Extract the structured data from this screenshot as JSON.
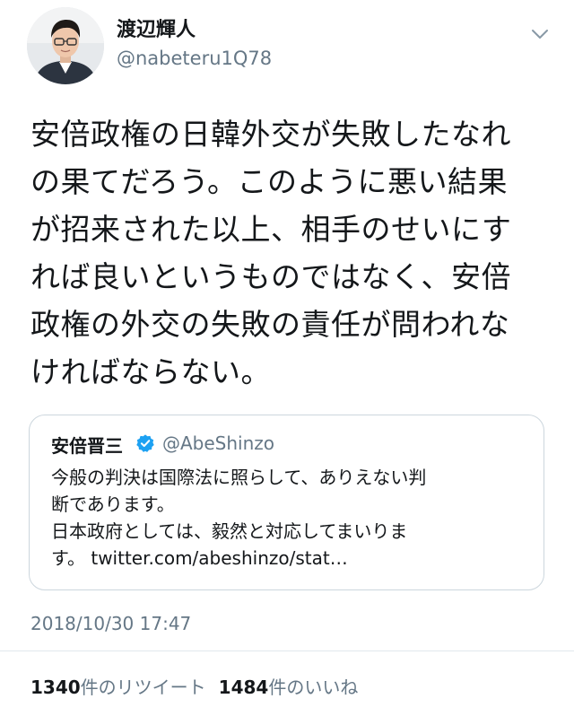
{
  "author": {
    "display_name": "渡辺輝人",
    "handle": "@nabeteru1Q78",
    "avatar_icon": "avatar-photo"
  },
  "menu_icon": "chevron-down-icon",
  "tweet_text_lines": [
    "安倍政権の日韓外交が失敗したなれ",
    "の果てだろう。このように悪い結果",
    "が招来された以上、相手のせいにす",
    "れば良いというものではなく、安倍",
    "政権の外交の失敗の責任が問われな",
    "ければならない。"
  ],
  "quoted_tweet": {
    "display_name": "安倍晋三",
    "verified_icon": "verified-badge-icon",
    "handle": "@AbeShinzo",
    "text_lines": [
      "今般の判決は国際法に照らして、ありえない判",
      "断であります。",
      "日本政府としては、毅然と対応してまいりま",
      "す。 twitter.com/abeshinzo/stat…"
    ]
  },
  "timestamp": "2018/10/30 17:47",
  "stats": {
    "retweet_count": "1340",
    "retweet_label": "件のリツイート",
    "like_count": "1484",
    "like_label": "件のいいね"
  },
  "colors": {
    "text": "#14171a",
    "secondary": "#657786",
    "border": "#ccd6dd",
    "verified": "#1da1f2"
  }
}
